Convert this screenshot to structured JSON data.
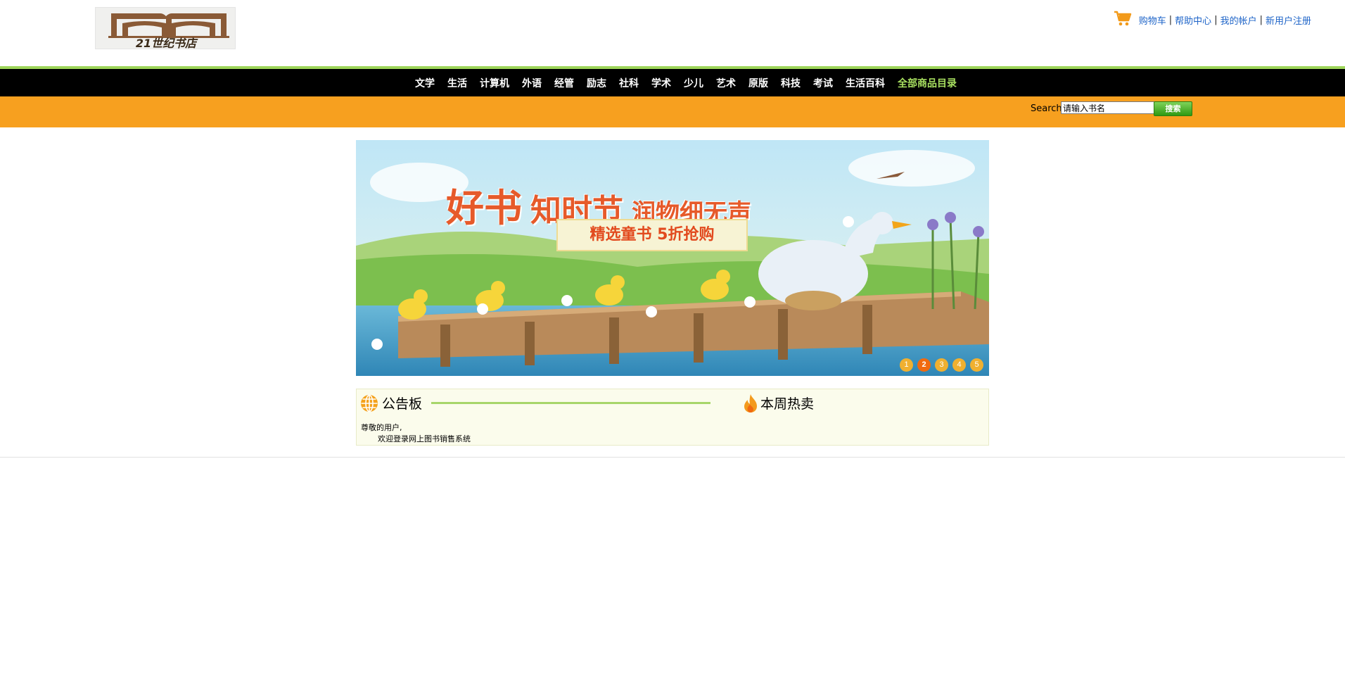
{
  "header": {
    "logo_text": "21世纪书店",
    "links": [
      "购物车",
      "帮助中心",
      "我的帐户",
      "新用户注册"
    ],
    "separator": "|"
  },
  "nav": {
    "items": [
      "文学",
      "生活",
      "计算机",
      "外语",
      "经管",
      "励志",
      "社科",
      "学术",
      "少儿",
      "艺术",
      "原版",
      "科技",
      "考试",
      "生活百科"
    ],
    "all_catalog": "全部商品目录"
  },
  "search": {
    "label": "Search",
    "value": "请输入书名",
    "button_label": "搜索"
  },
  "banner": {
    "headline_1": "好书",
    "headline_2": "知时节",
    "headline_3": "润物细无声",
    "ribbon": "精选童书 5折抢购",
    "pages": [
      "1",
      "2",
      "3",
      "4",
      "5"
    ],
    "active_page": "2"
  },
  "board": {
    "title": "公告板",
    "hot_title": "本周热卖",
    "greeting": "尊敬的用户,",
    "message": "欢迎登录网上图书销售系统"
  },
  "colors": {
    "nav_bg": "#000000",
    "accent_green": "#9ed55a",
    "search_bar": "#f7a01f",
    "link_blue": "#1e64c8",
    "pager_active": "#f06a10"
  }
}
